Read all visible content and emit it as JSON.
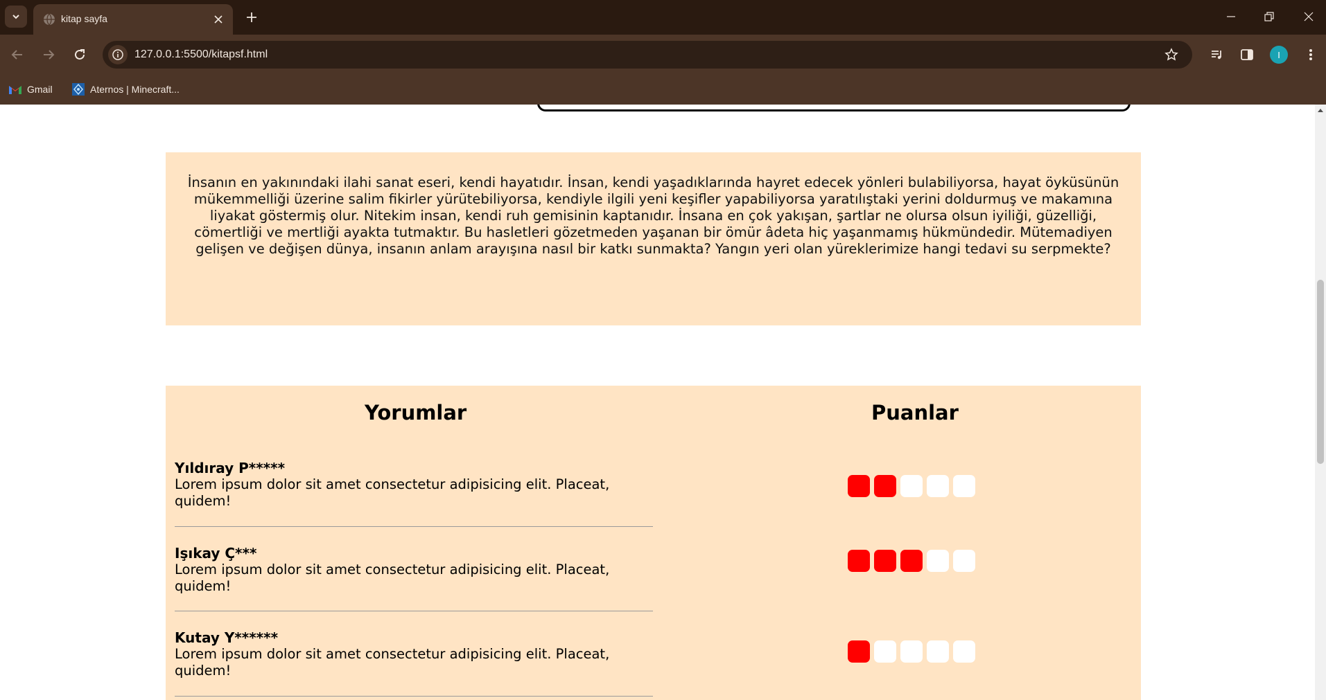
{
  "browser": {
    "tab_title": "kitap sayfa",
    "url": "127.0.0.1:5500/kitapsf.html",
    "profile_initial": "I",
    "bookmarks": [
      "Gmail",
      "Aternos | Minecraft..."
    ]
  },
  "description": "İnsanın en yakınındaki ilahi sanat eseri, kendi hayatıdır. İnsan, kendi yaşadıklarında hayret edecek yönleri bulabiliyorsa, hayat öyküsünün mükemmelliği üzerine salim fikirler yürütebiliyorsa, kendiyle ilgili yeni keşifler yapabiliyorsa yaratılıştaki yerini doldurmuş ve makamına liyakat göstermiş olur. Nitekim insan, kendi ruh gemisinin kaptanıdır. İnsana en çok yakışan, şartlar ne olursa olsun iyiliği, güzelliği, cömertliği ve mertliği ayakta tutmaktır. Bu hasletleri gözetmeden yaşanan bir ömür âdeta hiç yaşanmamış hükmündedir. Mütemadiyen gelişen ve değişen dünya, insanın anlam arayışına nasıl bir katkı sunmakta? Yangın yeri olan yüreklerimize hangi tedavi su serpmekte?",
  "reviews": {
    "comments_heading": "Yorumlar",
    "ratings_heading": "Puanlar",
    "items": [
      {
        "name": "Yıldıray P*****",
        "text": "Lorem ipsum dolor sit amet consectetur adipisicing elit. Placeat, quidem!",
        "rating": 2,
        "max": 5
      },
      {
        "name": "Işıkay Ç***",
        "text": "Lorem ipsum dolor sit amet consectetur adipisicing elit. Placeat, quidem!",
        "rating": 3,
        "max": 5
      },
      {
        "name": "Kutay Y******",
        "text": "Lorem ipsum dolor sit amet consectetur adipisicing elit. Placeat, quidem!",
        "rating": 1,
        "max": 5
      }
    ]
  },
  "colors": {
    "panel_bg": "#ffe4c4",
    "rating_on": "#ff0000",
    "rating_off": "#ffffff",
    "chrome_dark": "#2a1a10",
    "chrome": "#4c3527"
  }
}
